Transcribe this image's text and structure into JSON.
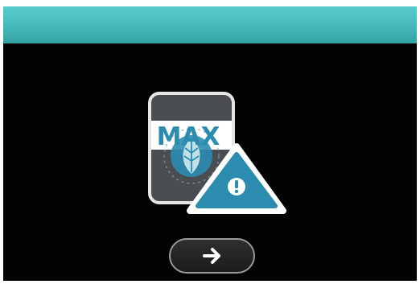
{
  "screen": {
    "badge_text": "MAX",
    "header_color": "#44b8b8",
    "background_color": "#030303",
    "accent_color": "#2b8cb0"
  },
  "icons": {
    "main": "filter-max-warning-icon",
    "warning": "warning-triangle-icon",
    "next": "arrow-right-icon"
  }
}
